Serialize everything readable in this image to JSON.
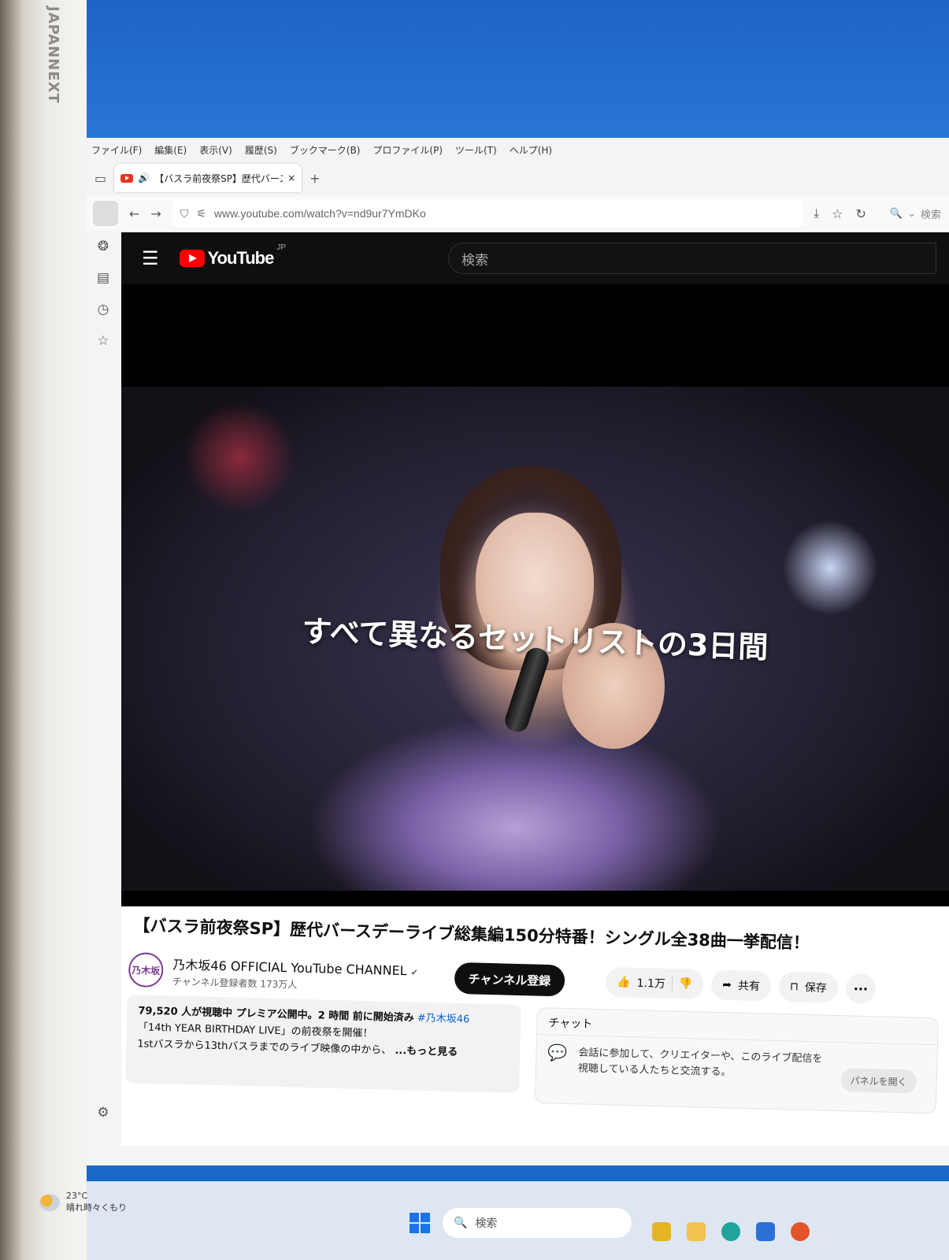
{
  "monitor": {
    "brand": "JAPANNEXT"
  },
  "browser": {
    "menu": [
      "ファイル(F)",
      "編集(E)",
      "表示(V)",
      "履歴(S)",
      "ブックマーク(B)",
      "プロファイル(P)",
      "ツール(T)",
      "ヘルプ(H)"
    ],
    "tab": {
      "title": "【バスラ前夜祭SP】歴代バースデ",
      "audio_icon": "speaker-icon",
      "close": "×"
    },
    "new_tab": "+",
    "url": "www.youtube.com/watch?v=nd9ur7YmDKo",
    "search_placeholder": "検索"
  },
  "youtube": {
    "logo_text": "YouTube",
    "region": "JP",
    "search_placeholder": "検索",
    "video_caption": "すべて異なるセットリストの3日間",
    "title": "【バスラ前夜祭SP】歴代バースデーライブ総集編150分特番！シングル全38曲一挙配信！",
    "channel": {
      "name": "乃木坂46 OFFICIAL YouTube CHANNEL",
      "verified": "✔",
      "subscribers": "チャンネル登録者数 173万人",
      "avatar_text": "乃木坂"
    },
    "subscribe_label": "チャンネル登録",
    "likes": "1.1万",
    "share_label": "共有",
    "save_label": "保存",
    "description": {
      "stats": "79,520 人が視聴中  プレミア公開中。2 時間 前に開始済み",
      "hashtag": "#乃木坂46",
      "line2": "「14th YEAR BIRTHDAY LIVE」の前夜祭を開催！",
      "line3": "1stバスラから13thバスラまでのライブ映像の中から、",
      "more": "...もっと見る"
    },
    "chat": {
      "header": "チャット",
      "text": "会話に参加して、クリエイターや、このライブ配信を視聴している人たちと交流する。",
      "open_panel": "パネルを開く"
    }
  },
  "taskbar": {
    "temperature": "23°C",
    "weather": "晴れ時々くもり",
    "search_label": "検索"
  }
}
